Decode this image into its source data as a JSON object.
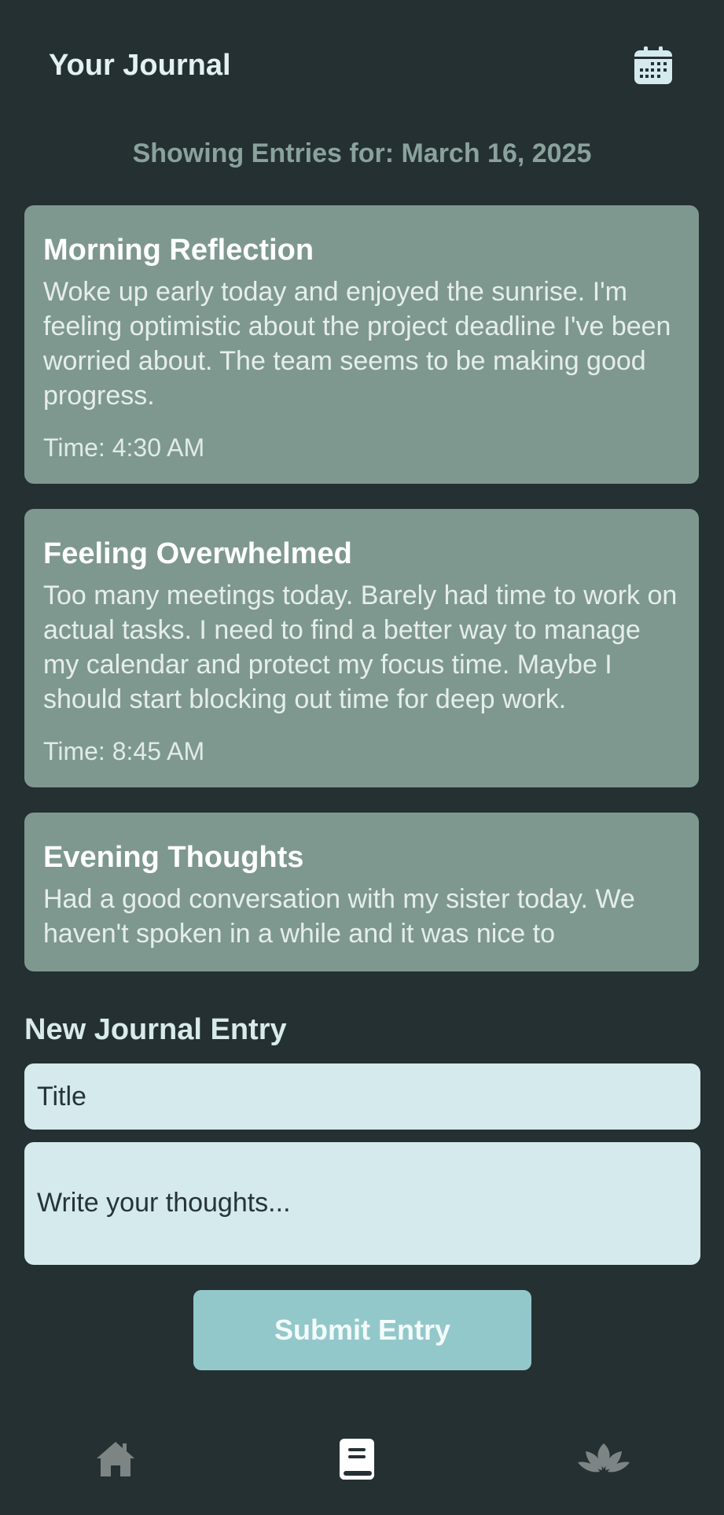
{
  "header": {
    "title": "Your Journal",
    "calendar_icon": "calendar-icon"
  },
  "showing_label": "Showing Entries for: March 16, 2025",
  "entries": [
    {
      "title": "Morning Reflection",
      "body": "Woke up early today and enjoyed the sunrise. I'm feeling optimistic about the project deadline I've been worried about. The team seems to be making good progress.",
      "time": "Time: 4:30 AM"
    },
    {
      "title": "Feeling Overwhelmed",
      "body": "Too many meetings today. Barely had time to work on actual tasks. I need to find a better way to manage my calendar and protect my focus time. Maybe I should start blocking out time for deep work.",
      "time": "Time: 8:45 AM"
    },
    {
      "title": "Evening Thoughts",
      "body": "Had a good conversation with my sister today. We haven't spoken in a while and it was nice to",
      "time": ""
    }
  ],
  "form": {
    "heading": "New Journal Entry",
    "title_placeholder": "Title",
    "body_placeholder": "Write your thoughts...",
    "submit_label": "Submit Entry"
  },
  "nav": {
    "items": [
      {
        "icon": "home-icon",
        "active": false
      },
      {
        "icon": "journal-book-icon",
        "active": true
      },
      {
        "icon": "lotus-icon",
        "active": false
      }
    ]
  },
  "colors": {
    "background": "#253033",
    "card": "#7e988f",
    "input": "#d4eaec",
    "button": "#93c8cb",
    "nav_inactive": "#7c8583",
    "nav_active": "#ffffff"
  }
}
